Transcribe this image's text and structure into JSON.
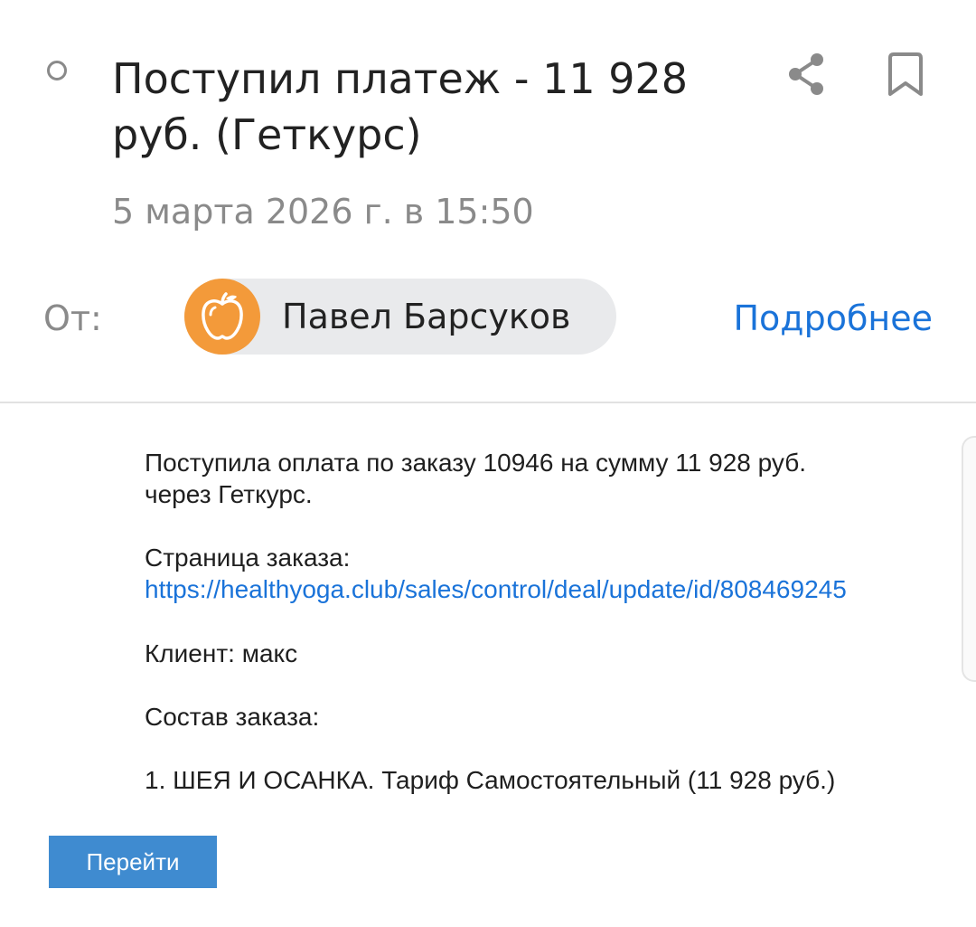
{
  "message": {
    "subject": "Поступил платеж - 11 928 руб. (Геткурс)",
    "date": "5 марта 2026 г. в 15:50",
    "from_label": "От:",
    "sender_name": "Павел Барсуков",
    "details_link": "Подробнее"
  },
  "icons": {
    "unread": "circle-outline-icon",
    "share": "share-icon",
    "bookmark": "bookmark-icon",
    "avatar": "apple-icon"
  },
  "body": {
    "line1": "Поступила оплата по заказу 10946 на сумму 11 928 руб.",
    "line2": "через Геткурс.",
    "order_page_label": "Страница заказа:",
    "order_page_url": "https://healthyoga.club/sales/control/deal/update/id/808469245",
    "client": "Клиент: макс",
    "order_contents_label": "Состав заказа:",
    "order_item": "1. ШЕЯ И ОСАНКА. Тариф Самостоятельный (11 928 руб.)",
    "go_button": "Перейти"
  },
  "colors": {
    "accent": "#1a73d9",
    "button": "#3f8bd0",
    "avatar": "#f39a3a",
    "muted_text": "#8a8a8a"
  }
}
